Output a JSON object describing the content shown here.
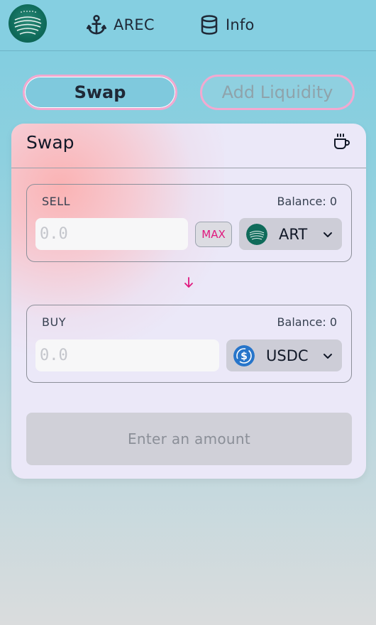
{
  "nav": {
    "arec_label": "AREC",
    "arec_icon": "anchor-icon",
    "info_label": "Info",
    "info_icon": "database-icon",
    "logo_icon": "arkreen-logo-icon"
  },
  "tabs": [
    {
      "label": "Swap",
      "active": true
    },
    {
      "label": "Add Liquidity",
      "active": false
    }
  ],
  "card": {
    "title": "Swap",
    "settings_icon": "coffee-cup-icon",
    "sell": {
      "label": "SELL",
      "balance_label": "Balance: 0",
      "amount_placeholder": "0.0",
      "amount_value": "",
      "max_label": "MAX",
      "token": {
        "symbol": "ART",
        "icon": "art-token-icon"
      }
    },
    "direction_icon": "arrow-down-icon",
    "buy": {
      "label": "BUY",
      "balance_label": "Balance: 0",
      "amount_placeholder": "0.0",
      "amount_value": "",
      "token": {
        "symbol": "USDC",
        "icon": "usdc-token-icon"
      }
    },
    "submit_label": "Enter an amount"
  },
  "colors": {
    "accent_pink": "#e0187e",
    "tab_border": "#f2a9d0",
    "card_bg": "#ebe8f8",
    "usdc_blue": "#2775ca",
    "art_green": "#0f6b5a"
  }
}
